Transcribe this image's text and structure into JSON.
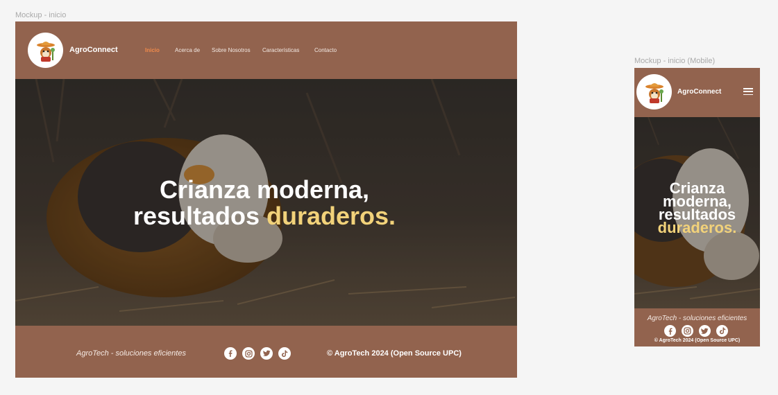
{
  "frames": {
    "desktop_label": "Mockup - inicio",
    "mobile_label": "Mockup -  inicio (Mobile)"
  },
  "brand": {
    "name": "AgroConnect",
    "logo_icon": "farmer-guinea-pig-icon"
  },
  "nav": {
    "items": [
      {
        "label": "Inicio",
        "active": true
      },
      {
        "label": "Acerca de",
        "active": false
      },
      {
        "label": "Sobre Nosotros",
        "active": false
      },
      {
        "label": "Características",
        "active": false
      },
      {
        "label": "Contacto",
        "active": false
      }
    ],
    "menu_icon": "hamburger-menu-icon"
  },
  "hero": {
    "line1": "Crianza moderna,",
    "line2_plain": "resultados ",
    "line2_accent": "duraderos.",
    "mobile_line1": "Crianza",
    "mobile_line2": "moderna,",
    "mobile_line3": "resultados",
    "mobile_line4": "duraderos.",
    "background": "guinea-pig-photo"
  },
  "footer": {
    "slogan": "AgroTech - soluciones eficientes",
    "copyright": "© AgroTech 2024 (Open Source UPC)",
    "social": [
      "facebook-icon",
      "instagram-icon",
      "twitter-icon",
      "tiktok-icon"
    ]
  },
  "colors": {
    "brown": "#92634e",
    "accent_yellow": "#f2d27a",
    "active_nav": "#f08a4b",
    "page_bg": "#f5f5f5"
  }
}
